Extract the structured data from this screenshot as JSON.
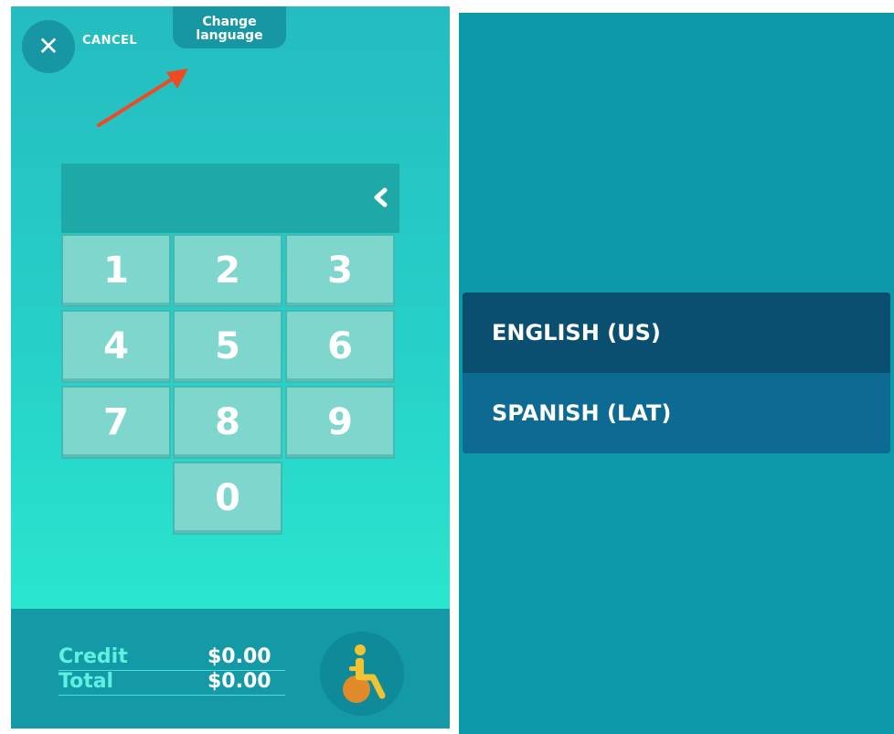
{
  "header": {
    "cancel_label": "CANCEL",
    "change_language_label": "Change\nlanguage"
  },
  "keypad": {
    "entered_value": "",
    "keys": [
      "1",
      "2",
      "3",
      "4",
      "5",
      "6",
      "7",
      "8",
      "9",
      "0"
    ]
  },
  "footer": {
    "credit_label": "Credit",
    "credit_value": "$0.00",
    "total_label": "Total",
    "total_value": "$0.00"
  },
  "language_menu": {
    "options": [
      {
        "label": "ENGLISH (US)",
        "selected": true
      },
      {
        "label": "SPANISH (LAT)",
        "selected": false
      }
    ]
  },
  "colors": {
    "accent": "#149aa6",
    "annotation_arrow": "#f04a22",
    "menu_selected": "#0a4f70",
    "menu_item": "#0d6a92"
  },
  "icons": {
    "cancel": "close-icon",
    "backspace": "chevron-left-icon",
    "accessibility": "wheelchair-icon"
  }
}
